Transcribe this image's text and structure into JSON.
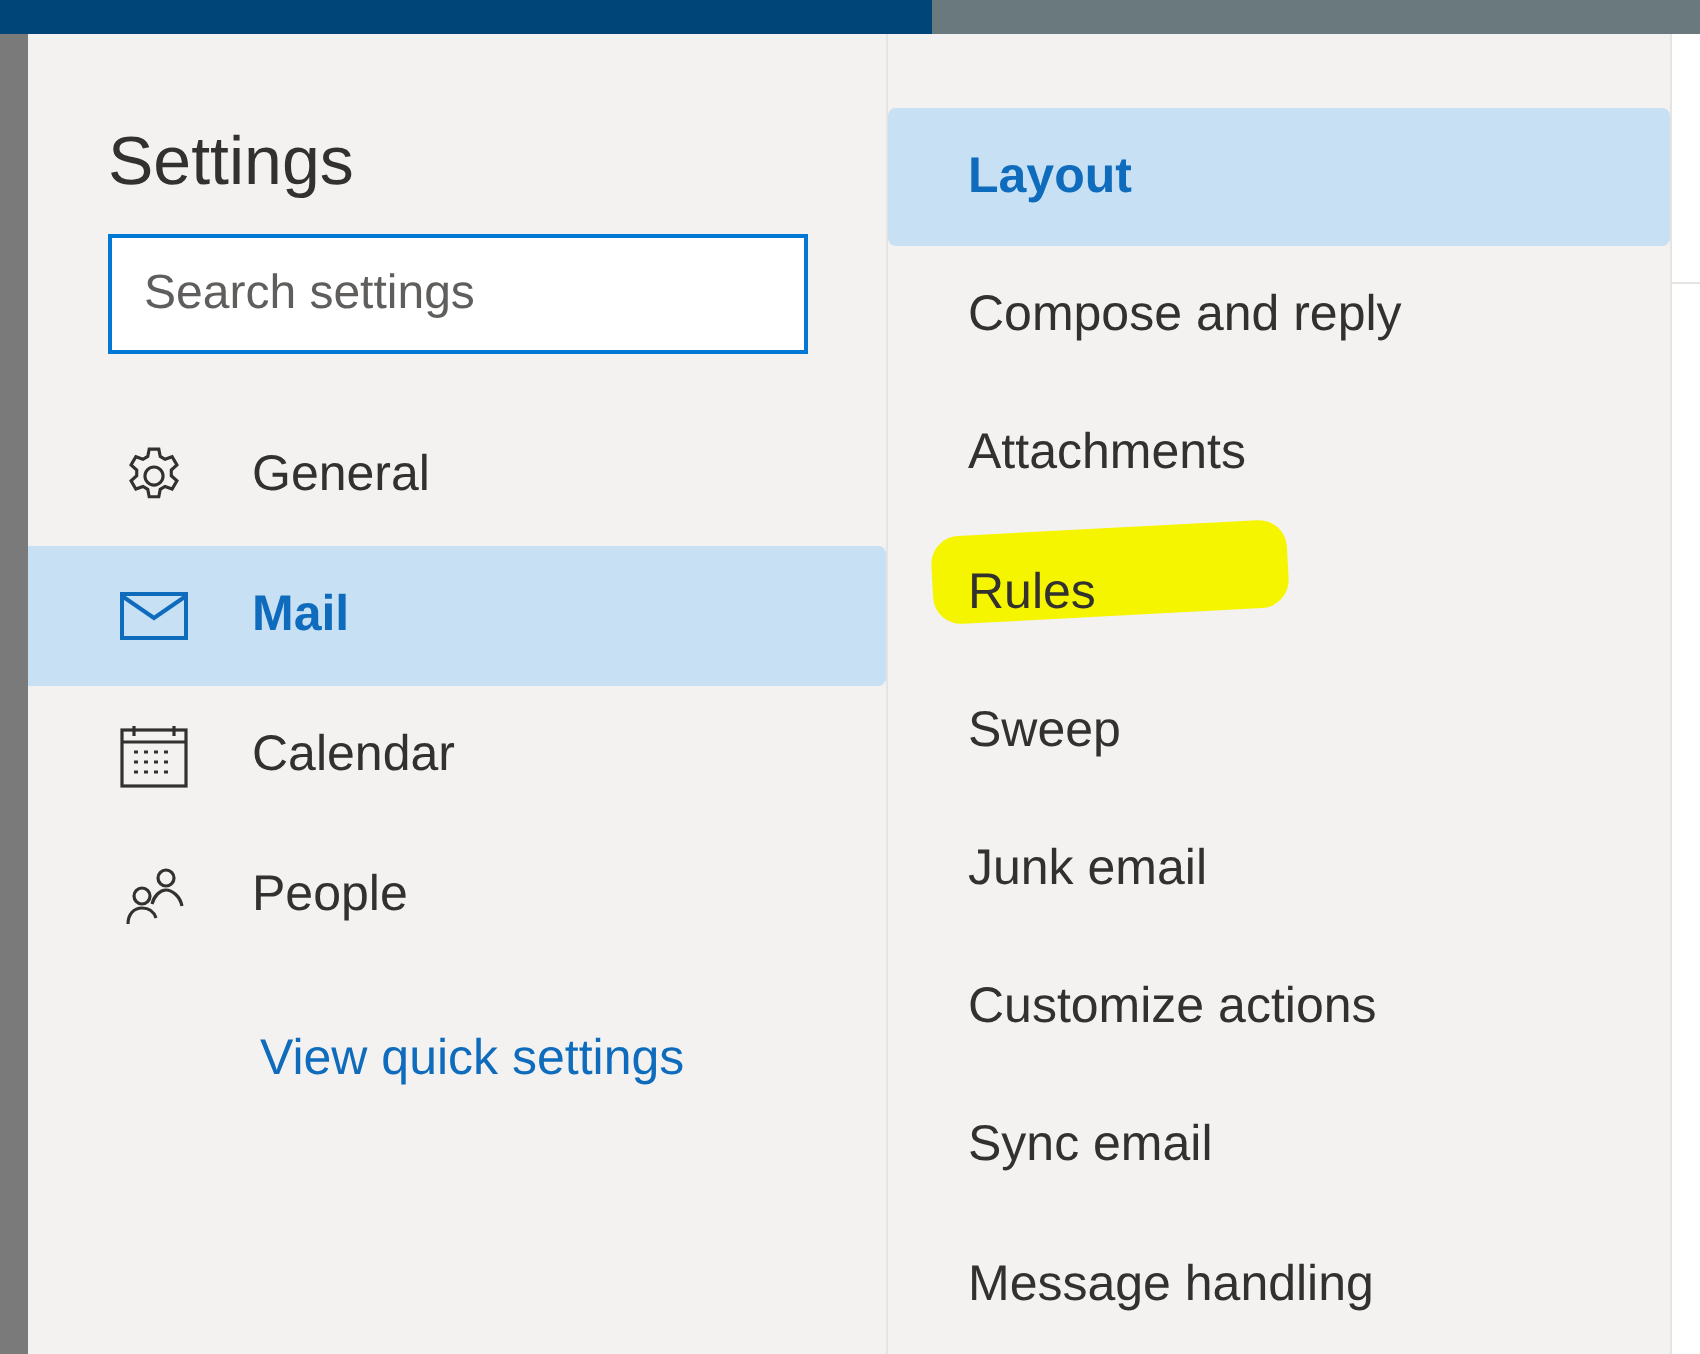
{
  "title": "Settings",
  "search": {
    "placeholder": "Search settings"
  },
  "categories": [
    {
      "kind": "gear",
      "label": "General",
      "selected": false
    },
    {
      "kind": "mail",
      "label": "Mail",
      "selected": true
    },
    {
      "kind": "calendar",
      "label": "Calendar",
      "selected": false
    },
    {
      "kind": "people",
      "label": "People",
      "selected": false
    }
  ],
  "quick_settings_link": "View quick settings",
  "subcategories": [
    {
      "label": "Layout",
      "selected": true,
      "highlighted": false
    },
    {
      "label": "Compose and reply",
      "selected": false,
      "highlighted": false
    },
    {
      "label": "Attachments",
      "selected": false,
      "highlighted": false
    },
    {
      "label": "Rules",
      "selected": false,
      "highlighted": true
    },
    {
      "label": "Sweep",
      "selected": false,
      "highlighted": false
    },
    {
      "label": "Junk email",
      "selected": false,
      "highlighted": false
    },
    {
      "label": "Customize actions",
      "selected": false,
      "highlighted": false
    },
    {
      "label": "Sync email",
      "selected": false,
      "highlighted": false
    },
    {
      "label": "Message handling",
      "selected": false,
      "highlighted": false
    }
  ]
}
